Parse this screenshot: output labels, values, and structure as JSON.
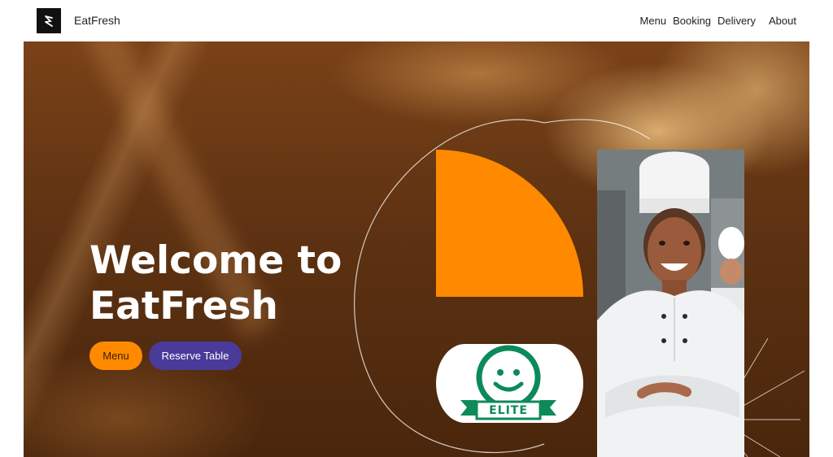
{
  "header": {
    "brand": "EatFresh",
    "nav": [
      "Menu",
      "Booking",
      "Delivery",
      "About"
    ]
  },
  "hero": {
    "title_line1": "Welcome to",
    "title_line2": "EatFresh",
    "menu_button": "Menu",
    "reserve_button": "Reserve Table"
  },
  "badge": {
    "label": "ELITE",
    "icon": "smiley-badge-icon"
  },
  "colors": {
    "accent_orange": "#ff8a00",
    "accent_purple": "#4a3a9a",
    "badge_green": "#0d8a5a"
  }
}
